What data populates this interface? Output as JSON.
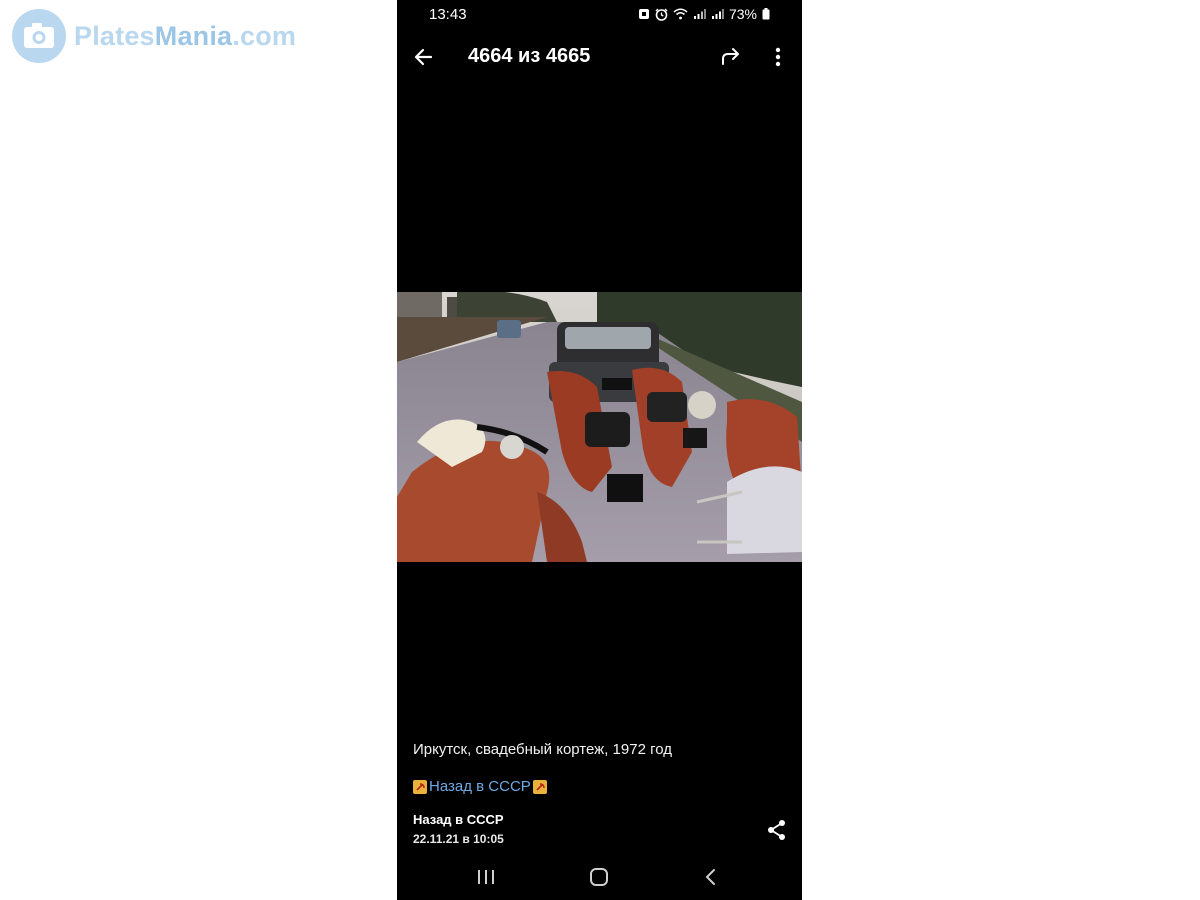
{
  "watermark": {
    "text_a": "Plates",
    "text_b": "Mania",
    "text_c": ".com",
    "icon": "camera-icon"
  },
  "status_bar": {
    "time": "13:43",
    "battery": "73%",
    "icons": [
      "alarm-icon",
      "clock-icon",
      "wifi-icon",
      "signal-icon",
      "signal-icon",
      "battery-icon"
    ]
  },
  "app_bar": {
    "counter": "4664 из 4665",
    "back_icon": "arrow-left-icon",
    "forward_icon": "share-forward-icon",
    "more_icon": "more-vertical-icon"
  },
  "photo": {
    "description_icon": "photo-image"
  },
  "post": {
    "caption": "Иркутск, свадебный кортеж, 1972 год",
    "tag": "Назад в СССР",
    "author": "Назад в СССР",
    "date": "22.11.21 в 10:05",
    "share_icon": "share-icon"
  },
  "nav": {
    "recents_icon": "recents-icon",
    "home_icon": "home-icon",
    "back_icon": "chevron-left-icon"
  },
  "colors": {
    "background": "#ffffff",
    "screen": "#000000",
    "link": "#6fa9e3",
    "watermark": "#b9d7ee"
  }
}
